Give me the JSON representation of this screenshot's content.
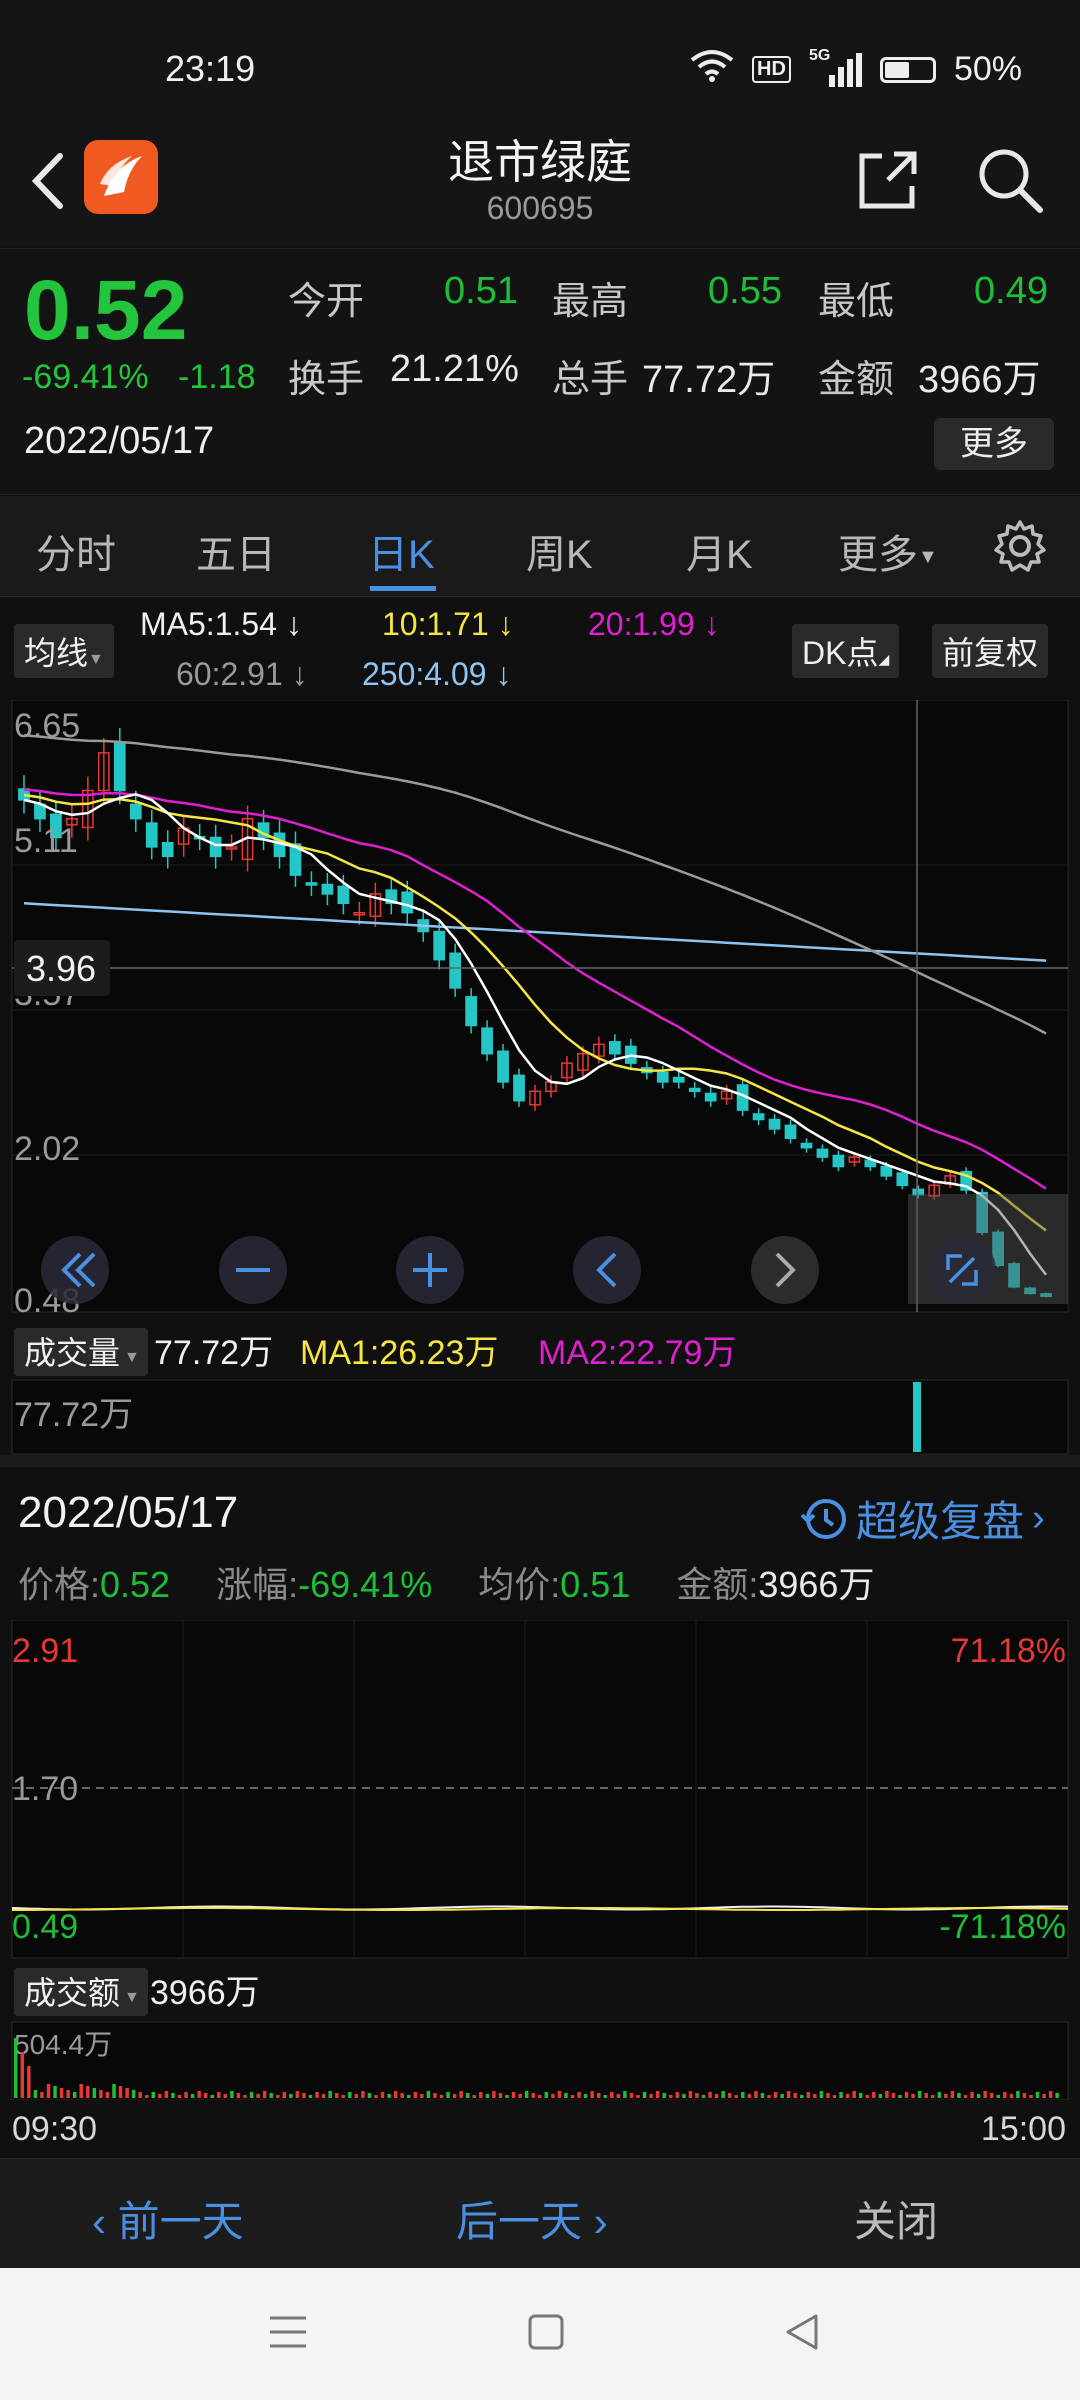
{
  "status_bar": {
    "time": "23:19",
    "network": "5G",
    "hd": "HD",
    "battery": "50%"
  },
  "header": {
    "title": "退市绿庭",
    "code": "600695"
  },
  "quote": {
    "price": "0.52",
    "change_pct": "-69.41%",
    "change_abs": "-1.18",
    "date": "2022/05/17",
    "open_label": "今开",
    "open": "0.51",
    "high_label": "最高",
    "high": "0.55",
    "low_label": "最低",
    "low": "0.49",
    "turnover_label": "换手",
    "turnover": "21.21%",
    "volume_label": "总手",
    "volume": "77.72万",
    "amount_label": "金额",
    "amount": "3966万",
    "more_label": "更多"
  },
  "tabs": [
    {
      "label": "分时"
    },
    {
      "label": "五日"
    },
    {
      "label": "日K"
    },
    {
      "label": "周K"
    },
    {
      "label": "月K"
    },
    {
      "label": "更多"
    }
  ],
  "ma": {
    "chip": "均线",
    "ma5": "MA5:1.54",
    "ma10": "10:1.71",
    "ma20": "20:1.99",
    "ma60": "60:2.91",
    "ma250": "250:4.09",
    "dk_label": "DK点",
    "fq_label": "前复权",
    "arrow": "↓"
  },
  "kline": {
    "y_labels": [
      "6.65",
      "5.11",
      "3.57",
      "2.02",
      "0.48"
    ],
    "crosshair_value": "3.96",
    "colors": {
      "ma5": "#ffffff",
      "ma10": "#f5e642",
      "ma20": "#e020d0",
      "ma60": "#9a9a9a",
      "ma250": "#8fc4f0",
      "up": "#e53935",
      "down": "#26c6c6"
    }
  },
  "volume": {
    "chip": "成交量",
    "value": "77.72万",
    "ma1": "MA1:26.23万",
    "ma2": "MA2:22.79万",
    "axis": "77.72万"
  },
  "replay": {
    "date": "2022/05/17",
    "button": "超级复盘",
    "price_label": "价格:",
    "price": "0.52",
    "chg_label": "涨幅:",
    "chg": "-69.41%",
    "avg_label": "均价:",
    "avg": "0.51",
    "amt_label": "金额:",
    "amt": "3966万"
  },
  "intraday": {
    "high": "2.91",
    "mid": "1.70",
    "low": "0.49",
    "high_pct": "71.18%",
    "low_pct": "-71.18%",
    "amt_chip": "成交额",
    "amt_value": "3966万",
    "amt_axis": "504.4万",
    "time_start": "09:30",
    "time_end": "15:00"
  },
  "nav": {
    "prev": "前一天",
    "next": "后一天",
    "close": "关闭"
  },
  "chart_data": {
    "type": "candlestick",
    "ylim": [
      0.48,
      6.65
    ],
    "moving_averages": [
      {
        "name": "MA5",
        "last": 1.54
      },
      {
        "name": "MA10",
        "last": 1.71
      },
      {
        "name": "MA20",
        "last": 1.99
      },
      {
        "name": "MA60",
        "last": 2.91
      },
      {
        "name": "MA250",
        "last": 4.09
      }
    ],
    "series": [
      {
        "name": "close",
        "values": [
          5.8,
          5.6,
          5.4,
          5.6,
          5.9,
          6.3,
          5.9,
          5.6,
          5.3,
          5.2,
          5.5,
          5.4,
          5.2,
          5.3,
          5.6,
          5.4,
          5.2,
          5.0,
          4.9,
          4.8,
          4.7,
          4.6,
          4.8,
          4.7,
          4.6,
          4.4,
          4.1,
          3.8,
          3.4,
          3.1,
          2.8,
          2.6,
          2.7,
          2.8,
          3.0,
          3.1,
          3.2,
          3.1,
          3.0,
          2.9,
          2.8,
          2.8,
          2.7,
          2.6,
          2.7,
          2.5,
          2.4,
          2.3,
          2.2,
          2.1,
          2.0,
          1.9,
          2.0,
          1.9,
          1.8,
          1.7,
          1.6,
          1.7,
          1.8,
          1.65,
          1.2,
          0.85,
          0.62,
          0.55,
          0.52
        ]
      }
    ]
  }
}
